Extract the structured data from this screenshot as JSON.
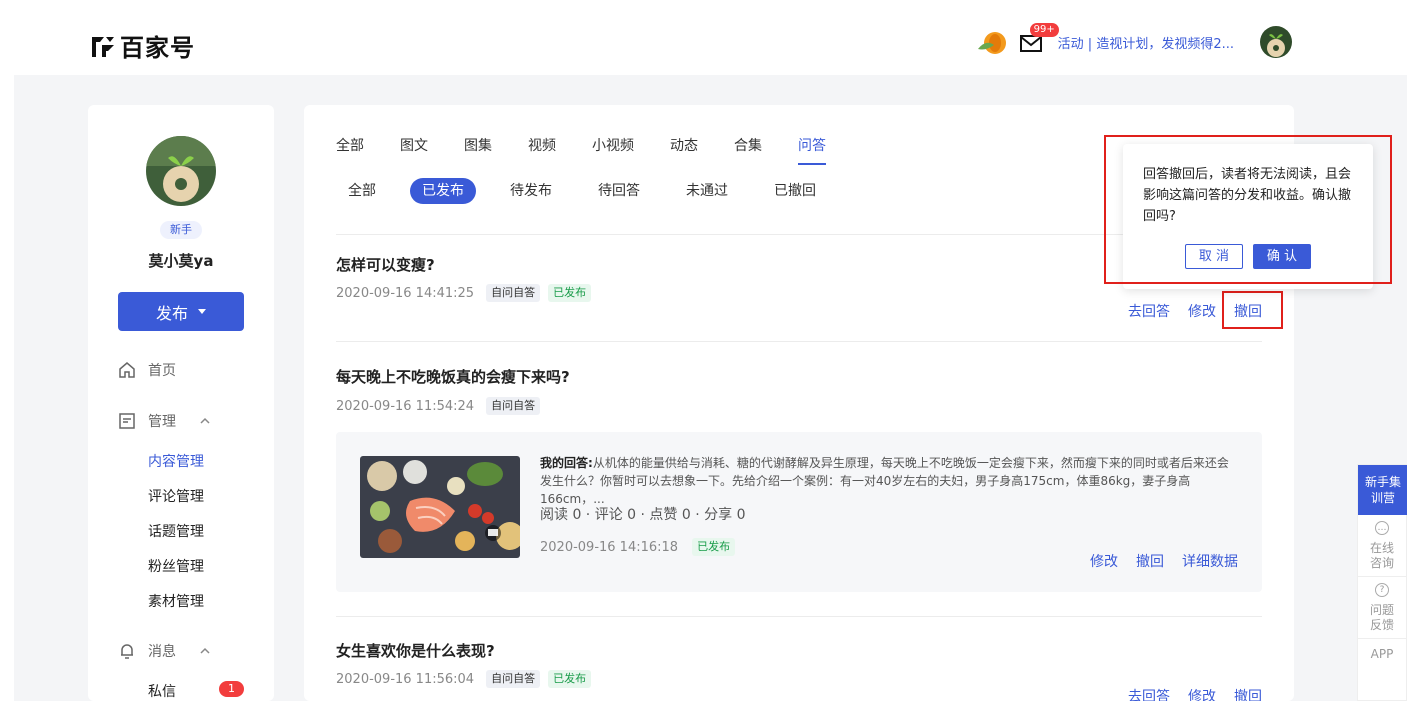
{
  "header": {
    "logo_text": "百家号",
    "mail_badge": "99+",
    "activity_text": "活动 | 造视计划，发视频得2..."
  },
  "sidebar": {
    "level_badge": "新手",
    "username": "莫小莫ya",
    "publish_label": "发布",
    "home_label": "首页",
    "manage_label": "管理",
    "manage_items": [
      "内容管理",
      "评论管理",
      "话题管理",
      "粉丝管理",
      "素材管理"
    ],
    "message_label": "消息",
    "message_items": [
      "私信"
    ],
    "dm_count": "1"
  },
  "main": {
    "tabs": [
      "全部",
      "图文",
      "图集",
      "视频",
      "小视频",
      "动态",
      "合集",
      "问答"
    ],
    "active_tab": "问答",
    "subtabs": [
      "全部",
      "已发布",
      "待发布",
      "待回答",
      "未通过",
      "已撤回"
    ],
    "active_subtab": "已发布",
    "questions": [
      {
        "title": "怎样可以变瘦?",
        "time": "2020-09-16 14:41:25",
        "tags": [
          "自问自答",
          "已发布"
        ],
        "actions": [
          "去回答",
          "修改",
          "撤回"
        ]
      },
      {
        "title": "每天晚上不吃晚饭真的会瘦下来吗?",
        "time": "2020-09-16 11:54:24",
        "tags": [
          "自问自答"
        ],
        "answer": {
          "label": "我的回答:",
          "text": "从机体的能量供给与消耗、糖的代谢酵解及异生原理，每天晚上不吃晚饭一定会瘦下来，然而瘦下来的同时或者后来还会发生什么？你暂时可以去想象一下。先给介绍一个案例：有一对40岁左右的夫妇，男子身高175cm，体重86kg，妻子身高166cm，...",
          "stats": "阅读 0 · 评论 0 · 点赞 0 · 分享 0",
          "time": "2020-09-16 14:16:18",
          "status": "已发布",
          "actions": [
            "修改",
            "撤回",
            "详细数据"
          ]
        }
      },
      {
        "title": "女生喜欢你是什么表现?",
        "time": "2020-09-16 11:56:04",
        "tags": [
          "自问自答",
          "已发布"
        ],
        "actions": [
          "去回答",
          "修改",
          "撤回"
        ]
      }
    ]
  },
  "popover": {
    "text": "回答撤回后，读者将无法阅读，且会影响这篇问答的分发和收益。确认撤回吗?",
    "cancel": "取 消",
    "confirm": "确 认"
  },
  "float": {
    "top": "新手集训营",
    "items": [
      "在线咨询",
      "问题反馈"
    ],
    "app": "APP"
  },
  "colors": {
    "accent": "#3a5ad7",
    "alert_red": "#e0201b",
    "published_green": "#1a9c4a"
  }
}
